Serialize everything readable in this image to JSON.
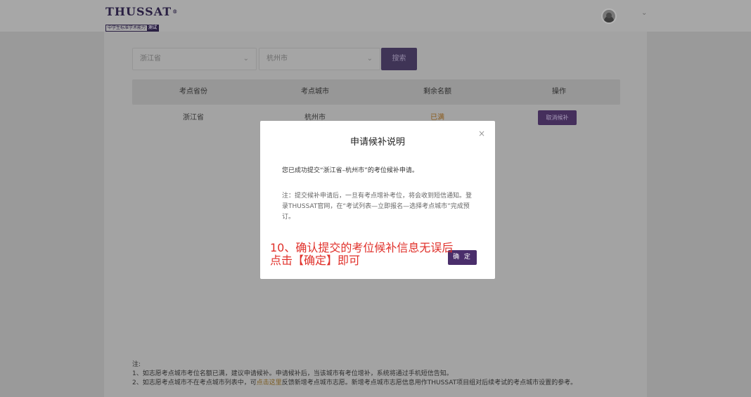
{
  "header": {
    "logo_text": "THUSSAT",
    "logo_reg": "®",
    "logo_sub": "中学生标准学术能力",
    "logo_tag": "测试",
    "user_menu_icon": "chevron-down-icon"
  },
  "filters": {
    "province_value": "浙江省",
    "city_value": "杭州市",
    "search_label": "搜索"
  },
  "table": {
    "headers": [
      "考点省份",
      "考点城市",
      "剩余名额",
      "操作"
    ],
    "rows": [
      {
        "province": "浙江省",
        "city": "杭州市",
        "remaining": "已满",
        "action": "取消候补"
      }
    ]
  },
  "notes": {
    "title": "注:",
    "line1": "1、如志愿考点城市考位名额已满，建议申请候补。申请候补后，当该城市有考位增补，系统将通过手机短信告知。",
    "line2_a": "2、如志愿考点城市不在考点城市列表中，可",
    "line2_link": "点击这里",
    "line2_b": "反馈新增考点城市志愿。新增考点城市志愿信息用作THUSSAT项目组对后续考试的考点城市设置的参考。"
  },
  "modal": {
    "title": "申请候补说明",
    "close": "×",
    "message": "您已成功提交“浙江省–杭州市”的考位候补申请。",
    "note": "注：提交候补申请后，一旦有考点增补考位，将会收到短信通知。登录THUSSAT官网，在“考试列表—立即报名—选择考点城市”完成预订。",
    "confirm_label": "确 定"
  },
  "annotation": {
    "line1": "10、确认提交的考位候补信息无误后",
    "line2": "点击【确定】即可"
  },
  "colors": {
    "accent": "#4a2e6b",
    "annotation": "#e0302a",
    "overlay": "#9a9a9a"
  }
}
